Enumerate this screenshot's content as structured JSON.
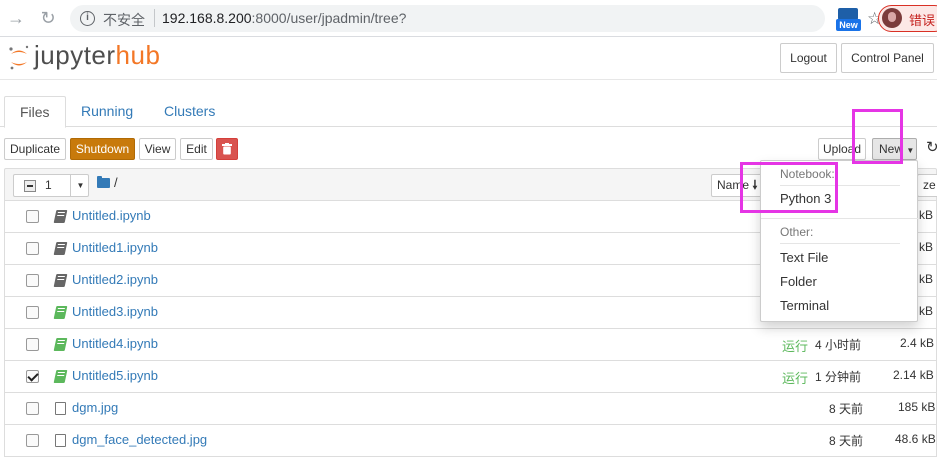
{
  "browser": {
    "insecure_label": "不安全",
    "url_host": "192.168.8.200",
    "url_path": ":8000/user/jpadmin/tree?",
    "extension_label": "New",
    "profile_status": "错误"
  },
  "header": {
    "logo_text": "jupyter",
    "logo_accent": "hub",
    "logout_label": "Logout",
    "control_panel_label": "Control Panel"
  },
  "tabs": [
    {
      "label": "Files",
      "active": true
    },
    {
      "label": "Running",
      "active": false
    },
    {
      "label": "Clusters",
      "active": false
    }
  ],
  "toolbar": {
    "duplicate_label": "Duplicate",
    "shutdown_label": "Shutdown",
    "view_label": "View",
    "edit_label": "Edit",
    "upload_label": "Upload",
    "new_label": "New"
  },
  "list_header": {
    "selected_count": "1",
    "breadcrumb": "/",
    "sort_name_label": "Name",
    "sort_size_label": "ze"
  },
  "files": [
    {
      "name": "Untitled.ipynb",
      "type": "notebook",
      "checked": false,
      "running": false,
      "running_label": "",
      "modified": "",
      "size": "kB"
    },
    {
      "name": "Untitled1.ipynb",
      "type": "notebook",
      "checked": false,
      "running": false,
      "running_label": "",
      "modified": "",
      "size": "kB"
    },
    {
      "name": "Untitled2.ipynb",
      "type": "notebook",
      "checked": false,
      "running": false,
      "running_label": "",
      "modified": "",
      "size": "kB"
    },
    {
      "name": "Untitled3.ipynb",
      "type": "notebook",
      "checked": false,
      "running": true,
      "running_label": "",
      "modified": "",
      "size": "kB"
    },
    {
      "name": "Untitled4.ipynb",
      "type": "notebook",
      "checked": false,
      "running": true,
      "running_label": "运行",
      "modified": "4 小时前",
      "size": "2.4 kB"
    },
    {
      "name": "Untitled5.ipynb",
      "type": "notebook",
      "checked": true,
      "running": true,
      "running_label": "运行",
      "modified": "1 分钟前",
      "size": "2.14 kB"
    },
    {
      "name": "dgm.jpg",
      "type": "file",
      "checked": false,
      "running": false,
      "running_label": "",
      "modified": "8 天前",
      "size": "185 kB"
    },
    {
      "name": "dgm_face_detected.jpg",
      "type": "file",
      "checked": false,
      "running": false,
      "running_label": "",
      "modified": "8 天前",
      "size": "48.6 kB"
    }
  ],
  "new_menu": {
    "notebook_header": "Notebook:",
    "notebook_items": [
      "Python 3"
    ],
    "other_header": "Other:",
    "other_items": [
      "Text File",
      "Folder",
      "Terminal"
    ]
  },
  "colors": {
    "link": "#337ab7",
    "running": "#5cb85c",
    "shutdown": "#c87a0b",
    "delete": "#d9534f",
    "highlight": "#e535e5",
    "brand_orange": "#f37726"
  }
}
